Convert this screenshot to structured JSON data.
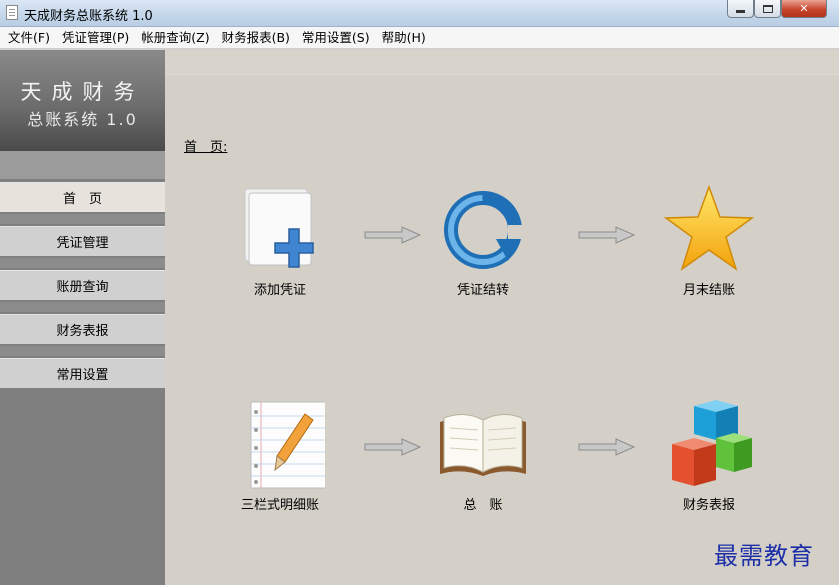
{
  "window": {
    "title": "天成财务总账系统 1.0"
  },
  "menu": {
    "items": [
      "文件(F)",
      "凭证管理(P)",
      "帐册查询(Z)",
      "财务报表(B)",
      "常用设置(S)",
      "帮助(H)"
    ]
  },
  "sidebar": {
    "brand_line1": "天成财务",
    "brand_line2": "总账系统 1.0",
    "items": [
      "首　页",
      "凭证管理",
      "账册查询",
      "财务表报",
      "常用设置"
    ]
  },
  "main": {
    "home_label": "首　页:",
    "tiles": [
      "添加凭证",
      "凭证结转",
      "月末结账",
      "三栏式明细账",
      "总　账",
      "财务表报"
    ]
  },
  "watermark": "最需教育"
}
